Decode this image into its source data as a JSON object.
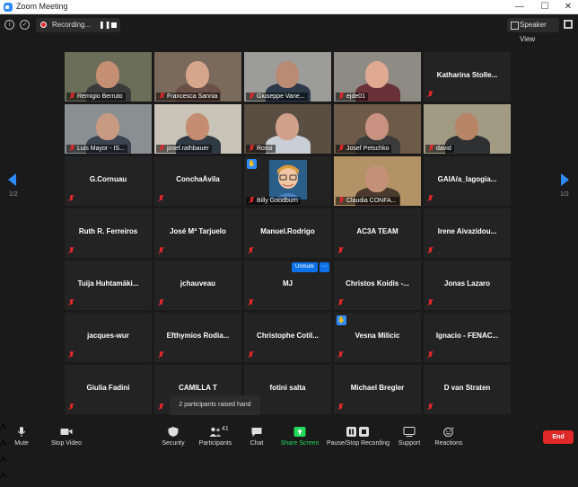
{
  "window": {
    "title": "Zoom Meeting",
    "minimize": "—",
    "maximize": "☐",
    "close": "✕"
  },
  "topbar": {
    "info_icon": "i",
    "shield_icon": "✓",
    "recording_label": "Recording...",
    "speaker_view_label": "Speaker View"
  },
  "pagination": {
    "left": "1/2",
    "right": "1/2"
  },
  "participants": [
    {
      "name": "Remigio Berruto",
      "video": true,
      "speaking": true,
      "bg": "#6b6e58",
      "skin": "#c58f74",
      "shirt": "#3a3a3a"
    },
    {
      "name": "Francesca Sannia",
      "video": true,
      "bg": "#7a6a5c",
      "skin": "#d6a58c",
      "shirt": "#6b5048"
    },
    {
      "name": "Giuseppe Vane...",
      "video": true,
      "bg": "#9c9d9a",
      "skin": "#b98b74",
      "shirt": "#2d3a4a"
    },
    {
      "name": "ejde01",
      "video": true,
      "bg": "#8e8a84",
      "skin": "#e0aa92",
      "shirt": "#6a3238"
    },
    {
      "name": "Katharina  Stolle...",
      "video": false
    },
    {
      "name": "Luis Mayor - IS...",
      "video": true,
      "bg": "#8a8f92",
      "skin": "#c89a82",
      "shirt": "#3c4350"
    },
    {
      "name": "josef.rathbauer",
      "video": true,
      "bg": "#c9c3b8",
      "skin": "#c48c70",
      "shirt": "#2f3a44"
    },
    {
      "name": "Rossi",
      "video": true,
      "bg": "#5a4e42",
      "skin": "#d0a08a",
      "shirt": "#c9cfd6"
    },
    {
      "name": "Josef Petschko",
      "video": true,
      "bg": "#6d5a48",
      "skin": "#c99280",
      "shirt": "#3b3b3b"
    },
    {
      "name": "david",
      "video": true,
      "bg": "#a39a84",
      "skin": "#b88466",
      "shirt": "#2e3032"
    },
    {
      "name": "G.Cornuau",
      "video": false
    },
    {
      "name": "ConchaÁvila",
      "video": false
    },
    {
      "name": "Billy Goodburn",
      "video": true,
      "avatar": true,
      "hand": true
    },
    {
      "name": "Claudia CONFA...",
      "video": true,
      "bg": "#b39266",
      "skin": "#c49178",
      "shirt": "#4a3a2e"
    },
    {
      "name": "GAIA/a_lagogia...",
      "video": false
    },
    {
      "name": "Ruth R. Ferreiros",
      "video": false
    },
    {
      "name": "José Mª Tarjuelo",
      "video": false
    },
    {
      "name": "Manuel.Rodrigo",
      "video": false
    },
    {
      "name": "AC3A TEAM",
      "video": false
    },
    {
      "name": "Irene  Aivazidou...",
      "video": false
    },
    {
      "name": "Tuija  Huhtamäki...",
      "video": false
    },
    {
      "name": "jchauveau",
      "video": false
    },
    {
      "name": "MJ",
      "video": false,
      "unmute": true
    },
    {
      "name": "Christos  Koidis  -...",
      "video": false
    },
    {
      "name": "Jonas Lazaro",
      "video": false
    },
    {
      "name": "jacques-wur",
      "video": false
    },
    {
      "name": "Efthymios  Rodia...",
      "video": false
    },
    {
      "name": "Christophe  Cotil...",
      "video": false
    },
    {
      "name": "Vesna Milicic",
      "video": false,
      "hand": true
    },
    {
      "name": "Ignacio  -  FENAC...",
      "video": false
    },
    {
      "name": "Giulia Fadini",
      "video": false
    },
    {
      "name": "CAMILLA T",
      "video": false
    },
    {
      "name": "fotini salta",
      "video": false
    },
    {
      "name": "Michael Bregler",
      "video": false
    },
    {
      "name": "D van Straten",
      "video": false
    }
  ],
  "tile_controls": {
    "unmute_label": "Unmute",
    "more_label": "···"
  },
  "toast": "2 participants raised hand",
  "toolbar": {
    "mute": "Mute",
    "stop_video": "Stop Video",
    "security": "Security",
    "participants": "Participants",
    "participants_count": "41",
    "chat": "Chat",
    "share_screen": "Share Screen",
    "pause_stop_recording": "Pause/Stop Recording",
    "support": "Support",
    "reactions": "Reactions",
    "end": "End"
  },
  "colors": {
    "accent": "#2d8cff",
    "share_green": "#23d959",
    "end_red": "#e02828",
    "speaking_outline": "#b5d94a",
    "tile_bg": "#232323"
  }
}
